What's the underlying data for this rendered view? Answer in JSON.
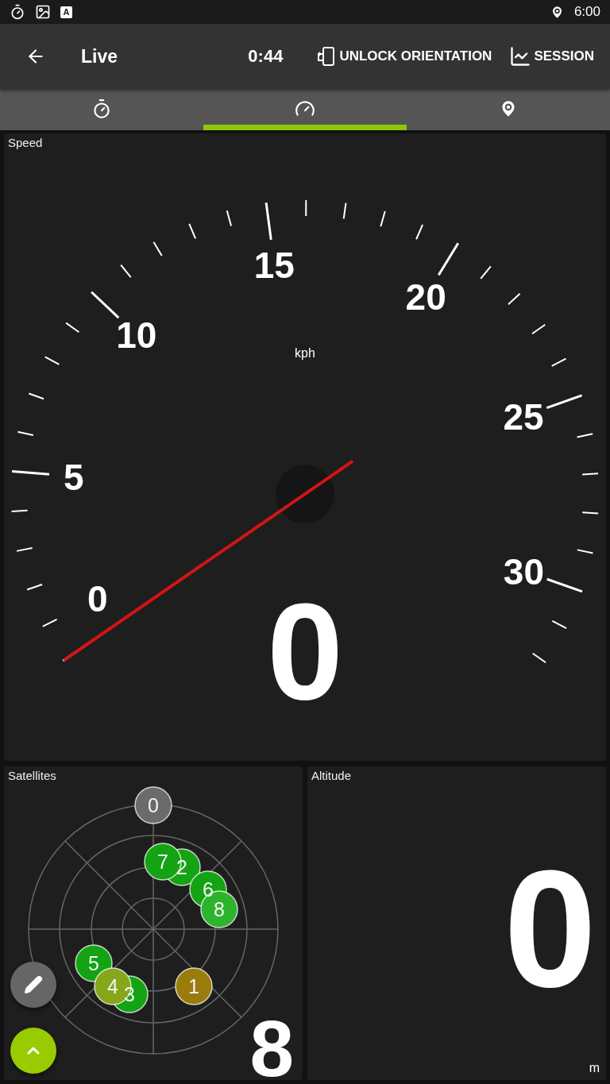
{
  "status_bar": {
    "notification_letter": "A",
    "time": "6:00"
  },
  "app_bar": {
    "title": "Live",
    "timer": "0:44",
    "actions": [
      {
        "kind": "orientation",
        "label": "UNLOCK ORIENTATION"
      },
      {
        "kind": "chart",
        "label": "SESSION"
      }
    ]
  },
  "tabs": [
    {
      "kind": "stopwatch",
      "selected": false
    },
    {
      "kind": "gauge",
      "selected": true
    },
    {
      "kind": "map",
      "selected": false
    }
  ],
  "speed": {
    "title": "Speed",
    "unit": "kph",
    "value": "0",
    "scale_labels": [
      "0",
      "5",
      "10",
      "15",
      "20",
      "25",
      "30"
    ]
  },
  "satellites": {
    "title": "Satellites",
    "count": "8",
    "items": [
      {
        "label": "0",
        "color": "#6b6b6b"
      },
      {
        "label": "2",
        "color": "#13a313"
      },
      {
        "label": "7",
        "color": "#13a313"
      },
      {
        "label": "6",
        "color": "#13a313"
      },
      {
        "label": "8",
        "color": "#2cb52c"
      },
      {
        "label": "3",
        "color": "#13a313"
      },
      {
        "label": "5",
        "color": "#13a313"
      },
      {
        "label": "4",
        "color": "#85a719"
      },
      {
        "label": "1",
        "color": "#9a7c0c"
      }
    ]
  },
  "altitude": {
    "title": "Altitude",
    "value": "0",
    "unit": "m"
  }
}
